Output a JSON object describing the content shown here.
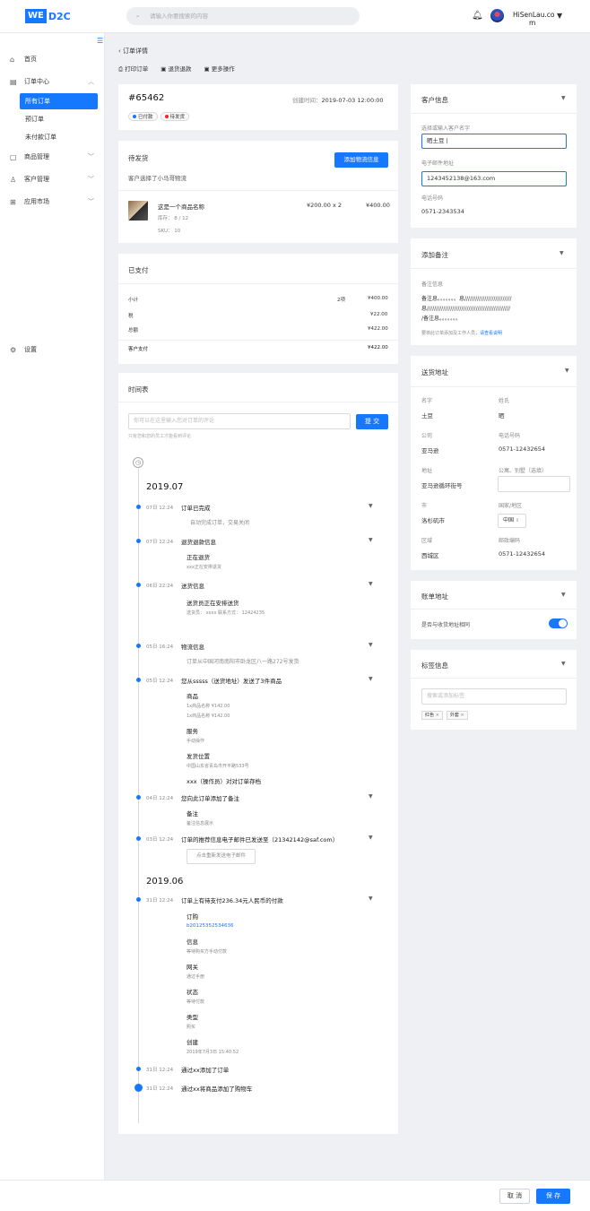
{
  "header": {
    "logo_we": "WE",
    "logo_d2c": "D2C",
    "search_placeholder": "请输入你要搜索的内容",
    "user_line1": "HiSenLau.co",
    "user_line2": "m"
  },
  "sidebar": {
    "home": "首页",
    "orders": "订单中心",
    "all_orders": "所有订单",
    "pre_orders": "预订单",
    "unpaid_orders": "未付款订单",
    "products": "商品管理",
    "customers": "客户管理",
    "apps": "应用市场",
    "settings": "设置"
  },
  "page": {
    "breadcrumb": "订单详情",
    "action_print": "打印订单",
    "action_return": "退货退款",
    "action_more": "更多操作"
  },
  "order": {
    "id": "#65462",
    "created_label": "创建时间：",
    "created_value": "2019-07-03 12:00:00",
    "badge_paid": "已付款",
    "badge_pending": "待发货"
  },
  "shipping": {
    "title": "待发货",
    "add_button": "添加物流信息",
    "note": "客户选择了小马哥物流",
    "item_name": "这是一个商品名称",
    "item_stock": "库存：  8 / 12",
    "item_sku": "SKU：  10",
    "item_price": "¥200.00  x 2",
    "item_total": "¥400.00"
  },
  "payment": {
    "title": "已支付",
    "subtotal_label": "小计",
    "subtotal_count": "2项",
    "subtotal_value": "¥400.00",
    "tax_label": "税",
    "tax_value": "¥22.00",
    "total_label": "总额",
    "total_value": "¥422.00",
    "paid_label": "客户支付",
    "paid_value": "¥422.00"
  },
  "timeline": {
    "title": "时间表",
    "comment_placeholder": "你可以在这里输入您对订单的评论",
    "submit": "提 交",
    "hint": "只有您和您的员工才能看到评论",
    "year1": "2019.07",
    "year2": "2019.06",
    "e1_time": "07日 12:24",
    "e1_title": "订单已完成",
    "e1_desc": "自动完成订单，交易关闭",
    "e2_time": "07日 12:24",
    "e2_title": "退货退款信息",
    "e2_sub": "正在退货",
    "e2_desc": "xxx正在安排退货",
    "e3_time": "06日 22:24",
    "e3_title": "送货信息",
    "e3_sub": "送货员正在安排送货",
    "e3_desc": "送货员：  xxxx      联系方式：  12424235",
    "e4_time": "05日 16:24",
    "e4_title": "物流信息",
    "e4_desc": "订单从中国河南南阳市卧龙区八一路272号发货",
    "e5_time": "05日 12:24",
    "e5_title": "您从sssss（送货地址）发送了3件商品",
    "e5_goods": "商品",
    "e5_g1": "1x商品名称   ¥142.00",
    "e5_g2": "1x商品名称   ¥142.00",
    "e5_service": "服务",
    "e5_service_v": "手动操作",
    "e5_loc": "发货位置",
    "e5_loc_v": "中国山东省青岛市开平路533号",
    "e5_archive": "xxx（操作员）对对订单存档",
    "e6_time": "04日 12:24",
    "e6_title": "您向此订单添加了备注",
    "e6_sub": "备注",
    "e6_desc": "备注信息展示",
    "e7_time": "03日 12:24",
    "e7_title": "订单的推荐信息电子邮件已发送至（21342142@saf.com）",
    "e7_button": "点击重新发送电子邮件",
    "e8_time": "31日 12:24",
    "e8_title": "订单上有待支付236.34元人民币的付款",
    "e8_order": "订购",
    "e8_order_v": "b20125352534636",
    "e8_info": "信息",
    "e8_info_v": "等待购买方手动付款",
    "e8_gateway": "网关",
    "e8_gateway_v": "通过手册",
    "e8_status": "状态",
    "e8_status_v": "等待付款",
    "e8_type": "类型",
    "e8_type_v": "购买",
    "e8_created": "创建",
    "e8_created_v": "2019年7月3日  15:40:52",
    "e9_time": "31日 12:24",
    "e9_title": "通过xx添加了订单",
    "e10_time": "31日 12:24",
    "e10_title": "通过xx将商品添加了购物车"
  },
  "customer": {
    "title": "客户信息",
    "name_label": "选择或输入客户名字",
    "name_value": "晒土豆 |",
    "email_label": "电子邮件地址",
    "email_value": "1243452138@163.com",
    "phone_label": "电话号码",
    "phone_value": "0571-2343534"
  },
  "remark": {
    "title": "添加备注",
    "label": "备注信息",
    "line1": "备注息。。。。。。。息//////////////////////////",
    "line2": "息//////////////////////////////////////////////",
    "line3": "/备注息。。。。。。。",
    "hint": "要将此订单添加及工作人员，",
    "hint_link": "请查看说明"
  },
  "address": {
    "title": "送货地址",
    "first_name_label": "名字",
    "first_name": "土豆",
    "last_name_label": "姓氏",
    "last_name": "晒",
    "company_label": "公司",
    "company": "亚马逊",
    "phone_label": "电话号码",
    "phone": "0571-12432654",
    "addr_label": "地址",
    "addr": "亚马逊循环街号",
    "apt_label": "公寓、别墅（选填）",
    "city_label": "市",
    "city": "洛杉矶市",
    "country_label": "国家/地区",
    "country": "中国",
    "district_label": "区域",
    "district": "西城区",
    "zip_label": "邮政编码",
    "zip": "0571-12432654"
  },
  "billing": {
    "title": "账单地址",
    "same_label": "是否与收货地址相同"
  },
  "tags": {
    "title": "标签信息",
    "placeholder": "搜索或添加标签",
    "t1": "红色",
    "t2": "外套"
  },
  "footer": {
    "cancel": "取 消",
    "save": "保 存"
  },
  "colors": {
    "accent": "#1677ff",
    "paid_dot": "#1677ff",
    "pending_dot": "#f5222d"
  }
}
